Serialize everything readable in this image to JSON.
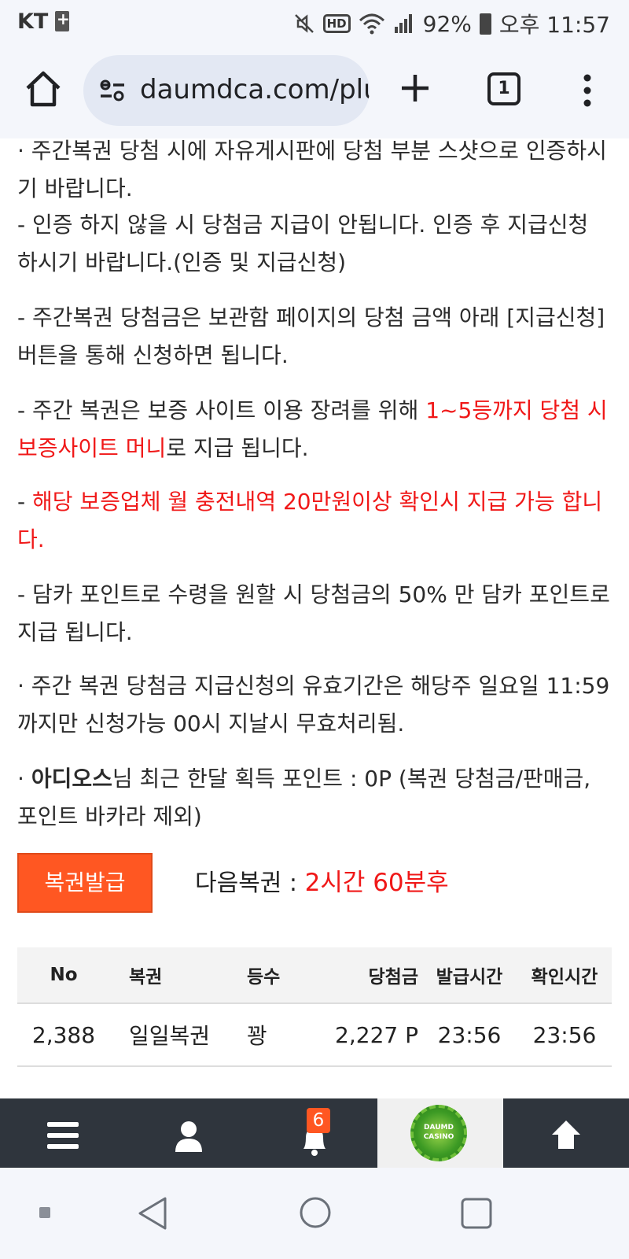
{
  "status_bar": {
    "carrier": "KT",
    "battery": "92%",
    "time": "오후 11:57"
  },
  "browser": {
    "url": "daumdca.com/plu",
    "tab_count": "1"
  },
  "notices": {
    "n1": "· 주간복권 당첨 시에 자유게시판에 당첨 부분 스샷으로 인증하시기 바랍니다.",
    "n2": "- 인증 하지 않을 시 당첨금 지급이 안됩니다. 인증 후 지급신청 하시기 바랍니다.(인증 및 지급신청)",
    "n3": "- 주간복권 당첨금은 보관함 페이지의 당첨 금액 아래 [지급신청] 버튼을 통해 신청하면 됩니다.",
    "n4_prefix": "- 주간 복권은 보증 사이트 이용 장려를 위해 ",
    "n4_red": "1~5등까지 당첨 시 보증사이트 머니",
    "n4_suffix": "로 지급 됩니다.",
    "n5_dash": "- ",
    "n5_red": "해당 보증업체 월 충전내역 20만원이상 확인시 지급 가능 합니다.",
    "n6": "- 담카 포인트로 수령을 원할 시 당첨금의 50% 만 담카 포인트로 지급 됩니다.",
    "n7": "· 주간 복권 당첨금 지급신청의 유효기간은 해당주 일요일 11:59까지만 신청가능 00시 지날시 무효처리됨.",
    "n8_bullet": "· ",
    "n8_name": "아디오스",
    "n8_rest": "님 최근 한달 획득 포인트 : 0P (복권 당첨금/판매금, 포인트 바카라 제외)"
  },
  "issue": {
    "button_label": "복권발급",
    "next_label": "다음복권 : ",
    "next_value": "2시간 60분후"
  },
  "table": {
    "headers": [
      "No",
      "복권",
      "등수",
      "당첨금",
      "발급시간",
      "확인시간"
    ],
    "rows": [
      [
        "2,388",
        "일일복권",
        "꽝",
        "2,227 P",
        "23:56",
        "23:56"
      ]
    ]
  },
  "app_nav": {
    "notification_count": "6",
    "casino_logo_top": "DAUMD",
    "casino_logo_bottom": "CASINO"
  },
  "colors": {
    "accent": "#ff5722",
    "highlight_red": "#f01818",
    "nav_bg": "#2f353d"
  }
}
